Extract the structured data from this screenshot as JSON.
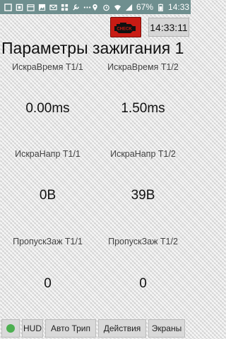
{
  "status_bar": {
    "battery": "67%",
    "time": "14:33",
    "left_icons": [
      "gallery-icon",
      "app-icon",
      "calendar-icon",
      "image-icon",
      "mail-icon",
      "grid-icon",
      "tools-icon",
      "more-dots-icon"
    ],
    "right_icons": [
      "location-icon",
      "alarm-icon",
      "wifi-icon",
      "signal-icon",
      "battery-icon"
    ]
  },
  "header": {
    "check_engine_text": "CHECK",
    "clock": "14:33:11",
    "title": "Параметры зажигания 1"
  },
  "gauges": [
    {
      "label": "ИскраВремя Т1/1",
      "value": "0.00ms"
    },
    {
      "label": "ИскраВремя Т1/2",
      "value": "1.50ms"
    },
    {
      "label": "ИскраНапр Т1/1",
      "value": "0В"
    },
    {
      "label": "ИскраНапр Т1/2",
      "value": "39В"
    },
    {
      "label": "ПропускЗаж Т1/1",
      "value": "0"
    },
    {
      "label": "ПропускЗаж Т1/2",
      "value": "0"
    }
  ],
  "bottom_bar": {
    "status_color": "#4caf50",
    "buttons": [
      "HUD",
      "Авто Трип",
      "Действия",
      "Экраны"
    ]
  }
}
